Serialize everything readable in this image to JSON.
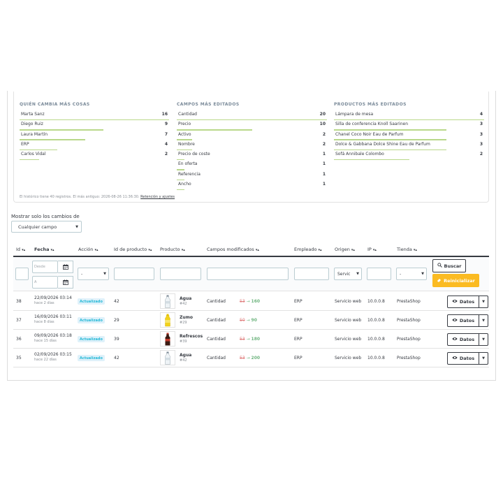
{
  "stats": {
    "who": {
      "title": "QUIÉN CAMBIA MÁS COSAS",
      "rows": [
        {
          "label": "Marta Sanz",
          "count": "16",
          "share": 1.0
        },
        {
          "label": "Diego Ruiz",
          "count": "9",
          "share": 0.56
        },
        {
          "label": "Laura Martín",
          "count": "7",
          "share": 0.44
        },
        {
          "label": "ERP",
          "count": "4",
          "share": 0.25
        },
        {
          "label": "Carlos Vidal",
          "count": "2",
          "share": 0.13
        }
      ]
    },
    "fields": {
      "title": "CAMPOS MÁS EDITADOS",
      "rows": [
        {
          "label": "Cantidad",
          "count": "20",
          "share": 1.0
        },
        {
          "label": "Precio",
          "count": "10",
          "share": 0.5
        },
        {
          "label": "Activo",
          "count": "2",
          "share": 0.1
        },
        {
          "label": "Nombre",
          "count": "2",
          "share": 0.1
        },
        {
          "label": "Precio de coste",
          "count": "1",
          "share": 0.05
        },
        {
          "label": "En oferta",
          "count": "1",
          "share": 0.05
        },
        {
          "label": "Referencia",
          "count": "1",
          "share": 0.05
        },
        {
          "label": "Ancho",
          "count": "1",
          "share": 0.05
        }
      ]
    },
    "products": {
      "title": "PRODUCTOS MÁS EDITADOS",
      "rows": [
        {
          "label": "Lámpara de mesa",
          "count": "4",
          "share": 1.0
        },
        {
          "label": "Silla de conferencia Knoll Saarinen",
          "count": "3",
          "share": 0.75
        },
        {
          "label": "Chanel Coco Noir Eau de Parfum",
          "count": "3",
          "share": 0.75
        },
        {
          "label": "Dolce & Gabbana Dolce Shine Eau de Parfum",
          "count": "3",
          "share": 0.75
        },
        {
          "label": "Sofá Annibale Colombo",
          "count": "2",
          "share": 0.5
        }
      ]
    },
    "footnote": "El histórico tiene 40 registros. El más antiguo: 2026-08-26 11:36:30.",
    "footnote_link": "Retención y ajustes"
  },
  "filter": {
    "label": "Mostrar solo los cambios de",
    "value": "Cualquier campo"
  },
  "table": {
    "headers": {
      "id": "Id",
      "fecha": "Fecha",
      "accion": "Acción",
      "id_producto": "Id de producto",
      "producto": "Producto",
      "campos": "Campos modificados",
      "empleado": "Empleado",
      "origen": "Origen",
      "ip": "IP",
      "tienda": "Tienda"
    },
    "sort_arrows": "▾▴",
    "filters": {
      "desde_placeholder": "Desde",
      "a_placeholder": "A",
      "accion_value": "-",
      "origen_value": "Servic",
      "tienda_value": "-",
      "search_label": "Buscar",
      "reset_label": "Reinicializar"
    },
    "rows": [
      {
        "id": "38",
        "date": "22/09/2026 03:14",
        "ago": "hace 2 días",
        "action": "Actualizado",
        "product_id": "42",
        "product_name": "Agua",
        "product_ref": "#42",
        "thumb": "water-bottle",
        "field": "Cantidad",
        "old": "53",
        "new": "160",
        "employee": "ERP",
        "origin": "Servicio web",
        "ip": "10.0.0.8",
        "shop": "PrestaShop",
        "btn": "Datos"
      },
      {
        "id": "37",
        "date": "16/09/2026 03:11",
        "ago": "hace 8 días",
        "action": "Actualizado",
        "product_id": "29",
        "product_name": "Zumo",
        "product_ref": "#29",
        "thumb": "juice-bottle",
        "field": "Cantidad",
        "old": "50",
        "new": "90",
        "employee": "ERP",
        "origin": "Servicio web",
        "ip": "10.0.0.8",
        "shop": "PrestaShop",
        "btn": "Datos"
      },
      {
        "id": "36",
        "date": "09/09/2026 03:18",
        "ago": "hace 15 días",
        "action": "Actualizado",
        "product_id": "39",
        "product_name": "Refrescos",
        "product_ref": "#39",
        "thumb": "soda-bottle",
        "field": "Cantidad",
        "old": "53",
        "new": "180",
        "employee": "ERP",
        "origin": "Servicio web",
        "ip": "10.0.0.8",
        "shop": "PrestaShop",
        "btn": "Datos"
      },
      {
        "id": "35",
        "date": "02/09/2026 03:15",
        "ago": "hace 22 días",
        "action": "Actualizado",
        "product_id": "42",
        "product_name": "Agua",
        "product_ref": "#42",
        "thumb": "water-bottle",
        "field": "Cantidad",
        "old": "53",
        "new": "200",
        "employee": "ERP",
        "origin": "Servicio web",
        "ip": "10.0.0.8",
        "shop": "PrestaShop",
        "btn": "Datos"
      }
    ],
    "arrow": "→"
  },
  "colors": {
    "bar": "#b9d88a",
    "accent_orange": "#fbbb22",
    "badge_bg": "#dff1fa",
    "badge_text": "#25b9d7",
    "old_value": "#e08080",
    "new_value": "#70b580"
  }
}
